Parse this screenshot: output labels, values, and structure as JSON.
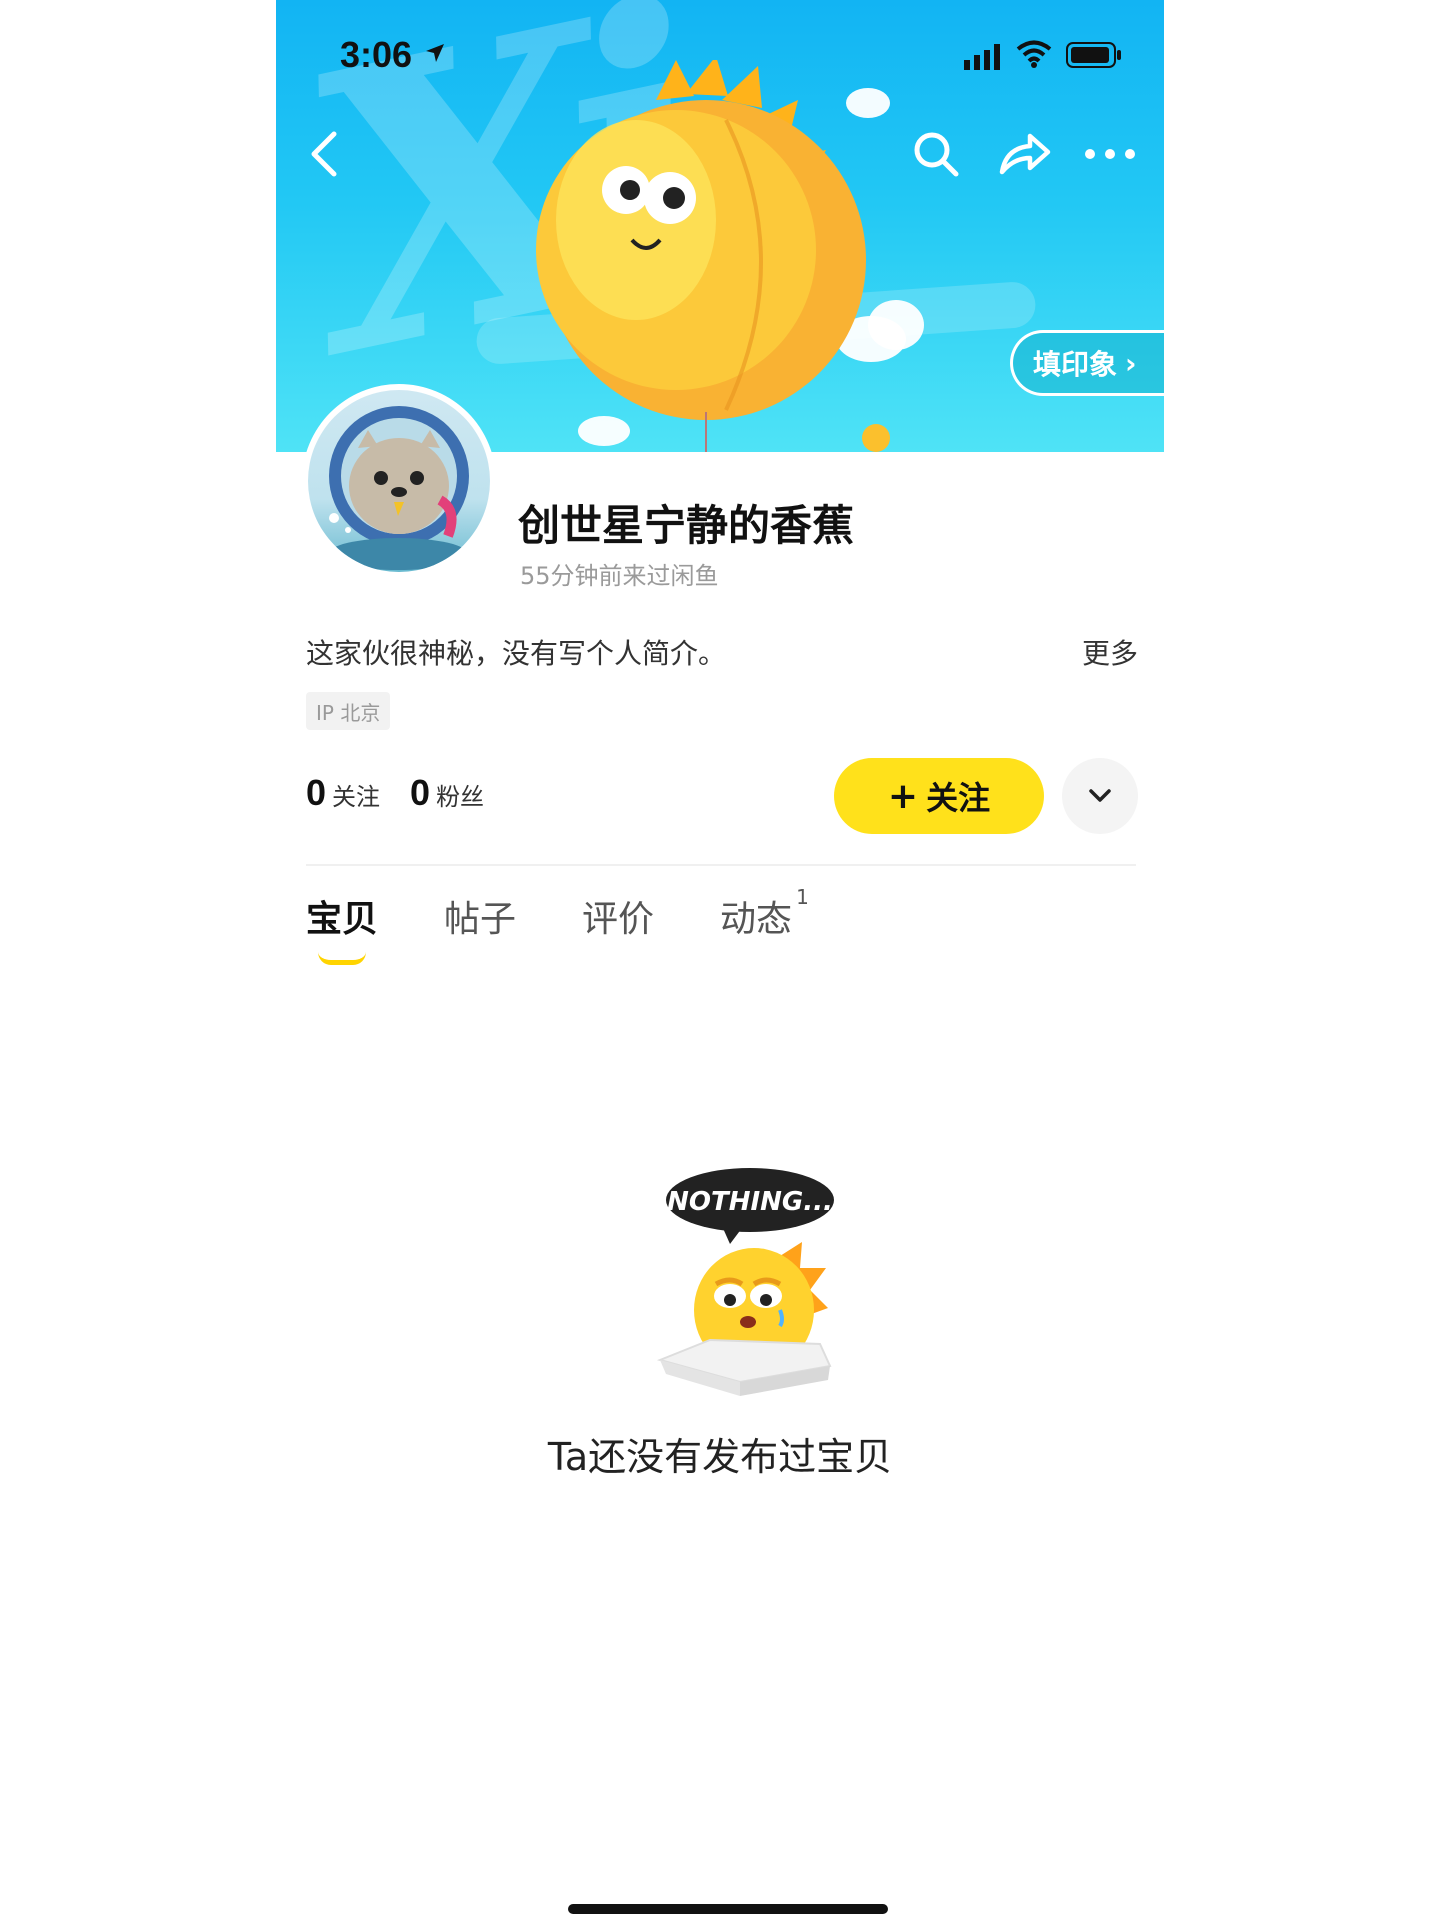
{
  "status_bar": {
    "time": "3:06"
  },
  "banner": {
    "brush_text": "Xi",
    "impression_label": "填印象"
  },
  "profile": {
    "username": "创世星宁静的香蕉",
    "last_seen": "55分钟前来过闲鱼",
    "bio": "这家伙很神秘，没有写个人简介。",
    "bio_more": "更多",
    "ip_location": "IP 北京"
  },
  "stats": [
    {
      "value": "0",
      "label": "关注"
    },
    {
      "value": "0",
      "label": "粉丝"
    }
  ],
  "actions": {
    "follow_label": "关注",
    "follow_plus": "+"
  },
  "tabs": [
    {
      "label": "宝贝",
      "active": true
    },
    {
      "label": "帖子"
    },
    {
      "label": "评价"
    },
    {
      "label": "动态",
      "badge": "1"
    }
  ],
  "empty_state": {
    "bubble_text": "NOTHING...",
    "message": "Ta还没有发布过宝贝"
  },
  "colors": {
    "accent_yellow": "#ffe11b",
    "banner_blue": "#22c8f4"
  }
}
